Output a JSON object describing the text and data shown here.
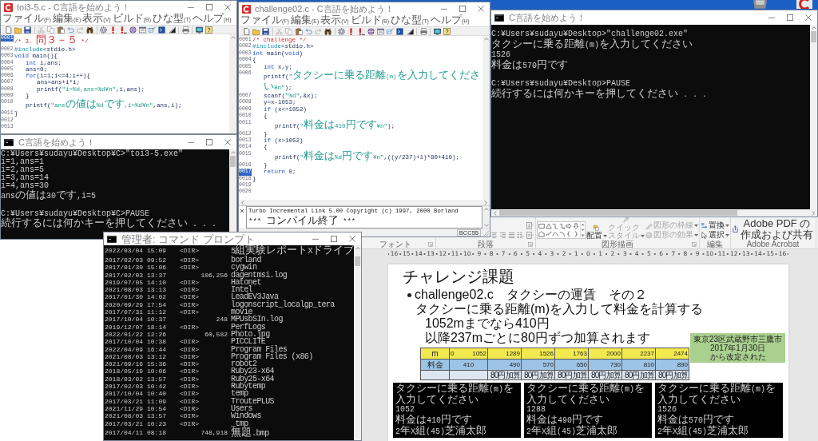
{
  "editors": [
    {
      "title": "toi3-5.c - C言語を始めよう！",
      "menu": [
        "ファイル(F)",
        "編集(E)",
        "表示(V)",
        "ビルド(B)",
        "ひな型(T)",
        "ヘルプ(H)"
      ],
      "lines": [
        {
          "number": "0001",
          "selected": true,
          "tokens": [
            {
              "kind": "comment",
              "text": "/* 3. 問３－５ */"
            }
          ]
        },
        {
          "number": "0002",
          "selected": false,
          "tokens": [
            {
              "kind": "directive",
              "text": "#include"
            },
            {
              "kind": "plain",
              "text": "<stdio.h>"
            }
          ]
        },
        {
          "number": "0003",
          "selected": false,
          "tokens": [
            {
              "kind": "keyword",
              "text": "void"
            },
            {
              "kind": "plain",
              "text": " main(){"
            }
          ]
        },
        {
          "number": "0004",
          "selected": false,
          "tokens": [
            {
              "kind": "keyword",
              "text": "    int"
            },
            {
              "kind": "plain",
              "text": " i,ans;"
            }
          ]
        },
        {
          "number": "0005",
          "selected": false,
          "tokens": [
            {
              "kind": "plain",
              "text": "    ans=0;"
            }
          ]
        },
        {
          "number": "0006",
          "selected": false,
          "tokens": [
            {
              "kind": "keyword",
              "text": "    for"
            },
            {
              "kind": "plain",
              "text": "(i=1;i<=4;i++){"
            }
          ]
        },
        {
          "number": "0007",
          "selected": false,
          "tokens": [
            {
              "kind": "plain",
              "text": "        ans=ans+i*i;"
            }
          ]
        },
        {
          "number": "0008",
          "selected": false,
          "tokens": [
            {
              "kind": "plain",
              "text": "        printf("
            },
            {
              "kind": "string",
              "text": "\"i=%d,ans=%d¥n\""
            },
            {
              "kind": "plain",
              "text": ",i,ans);"
            }
          ]
        },
        {
          "number": "0009",
          "selected": false,
          "tokens": [
            {
              "kind": "plain",
              "text": "    }"
            }
          ]
        },
        {
          "number": "0010",
          "selected": false,
          "tokens": [
            {
              "kind": "plain",
              "text": "    printf("
            },
            {
              "kind": "string",
              "text": "\"ansの値は%dです,i=%d¥n\""
            },
            {
              "kind": "plain",
              "text": ",ans,i);"
            }
          ]
        },
        {
          "number": "0011",
          "selected": false,
          "tokens": [
            {
              "kind": "plain",
              "text": "}"
            }
          ]
        },
        {
          "number": "0012",
          "selected": false
        },
        {
          "number": "0013",
          "selected": false
        }
      ]
    },
    {
      "title": "challenge02.c - C言語を始めよう！",
      "menu": [
        "ファイル(F)",
        "編集(E)",
        "表示(V)",
        "ビルド(B)",
        "ひな型(T)",
        "ヘルプ(H)"
      ],
      "lines": [
        {
          "number": "0001",
          "selected": false,
          "tokens": [
            {
              "kind": "comment",
              "text": "/* challenge */"
            }
          ]
        },
        {
          "number": "0002",
          "selected": false,
          "tokens": [
            {
              "kind": "directive",
              "text": "#include"
            },
            {
              "kind": "plain",
              "text": "<stdio.h>"
            }
          ]
        },
        {
          "number": "0003",
          "selected": false,
          "tokens": [
            {
              "kind": "keyword",
              "text": "int"
            },
            {
              "kind": "plain",
              "text": " main("
            },
            {
              "kind": "keyword",
              "text": "void"
            },
            {
              "kind": "plain",
              "text": ")"
            }
          ]
        },
        {
          "number": "0004",
          "selected": false,
          "tokens": [
            {
              "kind": "plain",
              "text": "{"
            }
          ]
        },
        {
          "number": "0005",
          "selected": false,
          "tokens": [
            {
              "kind": "keyword",
              "text": "    int"
            },
            {
              "kind": "plain",
              "text": " x,y;"
            }
          ]
        },
        {
          "number": "0006",
          "selected": false,
          "tokens": [
            {
              "kind": "plain",
              "text": "    printf("
            },
            {
              "kind": "string",
              "text": "\"タクシーに乗る距離(m)を入力してください¥n\""
            },
            {
              "kind": "plain",
              "text": ");"
            }
          ]
        },
        {
          "number": "0007",
          "selected": false,
          "tokens": [
            {
              "kind": "plain",
              "text": "    scanf("
            },
            {
              "kind": "string",
              "text": "\"%d\""
            },
            {
              "kind": "plain",
              "text": ",&x);"
            }
          ]
        },
        {
          "number": "0008",
          "selected": false,
          "tokens": [
            {
              "kind": "plain",
              "text": "    y=x-1053;"
            }
          ]
        },
        {
          "number": "0009",
          "selected": false,
          "tokens": [
            {
              "kind": "keyword",
              "text": "    if"
            },
            {
              "kind": "plain",
              "text": " (x<=1052)"
            }
          ]
        },
        {
          "number": "0010",
          "selected": false,
          "tokens": [
            {
              "kind": "plain",
              "text": "    {"
            }
          ]
        },
        {
          "number": "0011",
          "selected": false,
          "tokens": [
            {
              "kind": "plain",
              "text": "        printf("
            },
            {
              "kind": "string",
              "text": "\"料金は410円です¥n\""
            },
            {
              "kind": "plain",
              "text": ");"
            }
          ]
        },
        {
          "number": "0012",
          "selected": false,
          "tokens": [
            {
              "kind": "plain",
              "text": "    }"
            }
          ]
        },
        {
          "number": "0013",
          "selected": false,
          "tokens": [
            {
              "kind": "keyword",
              "text": "    if"
            },
            {
              "kind": "plain",
              "text": " (x>1052)"
            }
          ]
        },
        {
          "number": "0014",
          "selected": false,
          "tokens": [
            {
              "kind": "plain",
              "text": "    {"
            }
          ]
        },
        {
          "number": "0015",
          "selected": false,
          "tokens": [
            {
              "kind": "plain",
              "text": "        printf("
            },
            {
              "kind": "string",
              "text": "\"料金は%d円です¥n\""
            },
            {
              "kind": "plain",
              "text": ",((y/237)+1)*80+410);"
            }
          ]
        },
        {
          "number": "0016",
          "selected": false,
          "tokens": [
            {
              "kind": "plain",
              "text": "    }"
            }
          ]
        },
        {
          "number": "0017",
          "selected": true,
          "tokens": [
            {
              "kind": "keyword",
              "text": "    return"
            },
            {
              "kind": "plain",
              "text": " 0;"
            }
          ]
        },
        {
          "number": "0018",
          "selected": false,
          "tokens": [
            {
              "kind": "plain",
              "text": "}"
            }
          ]
        },
        {
          "number": "0019",
          "selected": false
        },
        {
          "number": "0020",
          "selected": false
        }
      ],
      "output": [
        "Turbo Incremental Link 5.00 Copyright (c) 1997, 2000 Borland",
        "*** コンパイル終了 ***"
      ],
      "status": "BCC55"
    }
  ],
  "consoles": [
    {
      "title": "C言語を始めよう！",
      "blocks": [
        [
          "C:¥Users¥sudayu¥Desktop>\"challenge02.exe\"",
          "タクシーに乗る距離(m)を入力してください",
          "1526",
          "料金は570円です"
        ],
        [
          "C:¥Users¥sudayu¥Desktop>PAUSE",
          "続行するには何かキーを押してください . . ."
        ]
      ]
    },
    {
      "title": "C言語を始めよう！",
      "blocks": [
        [
          "C:¥Users¥sudayu¥Desktop¥C>\"toi3-5.exe\"",
          "i=1,ans=1",
          "i=2,ans=5",
          "i=3,ans=14",
          "i=4,ans=30",
          "ansの値は30です,i=5"
        ],
        [
          "C:¥Users¥sudayu¥Desktop¥C>PAUSE",
          "続行するには何かキーを押してください . . ."
        ]
      ]
    }
  ],
  "command_prompt": {
    "title": "管理者: コマンド プロンプト",
    "rows": [
      {
        "date": "2022/03/04",
        "time": "15:09",
        "dir": "<DIR>",
        "name": "5組実験レポートXドライブ"
      },
      {
        "date": "2017/02/03",
        "time": "09:52",
        "dir": "<DIR>",
        "name": "borland"
      },
      {
        "date": "2017/01/30",
        "time": "15:06",
        "dir": "<DIR>",
        "name": "cygwin"
      },
      {
        "date": "2017/02/03",
        "time": "13:37",
        "size": "106,256",
        "name": "dagentmsi.log"
      },
      {
        "date": "2019/07/05",
        "time": "14:10",
        "dir": "<DIR>",
        "name": "Hatonet"
      },
      {
        "date": "2021/08/03",
        "time": "13:13",
        "dir": "<DIR>",
        "name": "Intel"
      },
      {
        "date": "2017/01/30",
        "time": "14:02",
        "dir": "<DIR>",
        "name": "LeadEV3Java"
      },
      {
        "date": "2020/09/29",
        "time": "17:54",
        "dir": "<DIR>",
        "name": "logonscript_localgp_tera"
      },
      {
        "date": "2017/07/31",
        "time": "11:12",
        "dir": "<DIR>",
        "name": "movie"
      },
      {
        "date": "2017/10/04",
        "time": "10:37",
        "size": "248",
        "name": "MPUsbSIn.log"
      },
      {
        "date": "2019/12/07",
        "time": "18:14",
        "dir": "<DIR>",
        "name": "PerfLogs"
      },
      {
        "date": "2022/01/22",
        "time": "12:26",
        "size": "60,582",
        "name": "Photo.jpg"
      },
      {
        "date": "2017/10/04",
        "time": "10:38",
        "dir": "<DIR>",
        "name": "PICCLITE"
      },
      {
        "date": "2022/04/09",
        "time": "16:44",
        "dir": "<DIR>",
        "name": "Program Files"
      },
      {
        "date": "2021/08/03",
        "time": "13:12",
        "dir": "<DIR>",
        "name": "Program Files (x86)"
      },
      {
        "date": "2021/09/16",
        "time": "15:36",
        "dir": "<DIR>",
        "name": "robot2"
      },
      {
        "date": "2018/05/19",
        "time": "10:06",
        "dir": "<DIR>",
        "name": "Ruby23-x64"
      },
      {
        "date": "2018/03/02",
        "time": "13:57",
        "dir": "<DIR>",
        "name": "Ruby25-x64"
      },
      {
        "date": "2017/02/03",
        "time": "10:42",
        "dir": "<DIR>",
        "name": "Rubytemp"
      },
      {
        "date": "2017/10/04",
        "time": "10:40",
        "dir": "<DIR>",
        "name": "temp"
      },
      {
        "date": "2017/03/21",
        "time": "11:09",
        "dir": "<DIR>",
        "name": "TroutePLUS"
      },
      {
        "date": "2021/11/29",
        "time": "10:54",
        "dir": "<DIR>",
        "name": "Users"
      },
      {
        "date": "2021/08/03",
        "time": "13:57",
        "dir": "<DIR>",
        "name": "Windows"
      },
      {
        "date": "2017/03/21",
        "time": "10:23",
        "dir": "<DIR>",
        "name": "_tmp"
      },
      {
        "date": "2017/04/11",
        "time": "08:18",
        "size": "748,918",
        "name": "無題.bmp"
      }
    ]
  },
  "presentation": {
    "ribbon": {
      "groups": [
        {
          "kind": "font",
          "label": "フォント"
        },
        {
          "kind": "paragraph",
          "label": "段落"
        },
        {
          "kind": "drawing",
          "label": "図形描画",
          "buttons": [
            {
              "kind": "large",
              "label": "配置",
              "dropdown": true,
              "disabled": false
            },
            {
              "kind": "large",
              "label": "クイックスタイル",
              "dropdown": true,
              "disabled": true
            },
            {
              "kind": "small",
              "label": "図形の枠線",
              "dropdown": true,
              "disabled": true
            },
            {
              "kind": "small",
              "label": "図形の効果",
              "dropdown": true,
              "disabled": true
            }
          ]
        },
        {
          "kind": "editing",
          "label": "編集",
          "buttons": [
            {
              "kind": "small",
              "label": "置換",
              "dropdown": true,
              "disabled": false
            },
            {
              "kind": "small",
              "label": "選択",
              "dropdown": true,
              "disabled": false
            }
          ]
        },
        {
          "kind": "acrobat",
          "label": "Adobe Acrobat",
          "buttons": [
            {
              "kind": "large",
              "label": "Adobe PDF の作成および共有",
              "dropdown": false,
              "disabled": false
            }
          ]
        }
      ]
    },
    "ruler": [
      "16",
      "15",
      "14",
      "13",
      "12",
      "11",
      "10",
      "9",
      "8",
      "7",
      "6",
      "5",
      "4",
      "3",
      "2",
      "1",
      "0",
      "1",
      "2",
      "3",
      "4",
      "5",
      "6",
      "7",
      "8",
      "9",
      "10",
      "11",
      "12",
      "13",
      "14",
      "15",
      "16"
    ],
    "slide": {
      "title": "チャレンジ課題",
      "bullets": [
        {
          "text": "challenge02.c　タクシーの運賃　その２",
          "children": [
            {
              "text": "タクシーに乗る距離(m)を入力して料金を計算する",
              "children": [
                {
                  "text": "1052mまでなら410円"
                },
                {
                  "text": "以降237mごとに80円ずつ加算されます"
                }
              ]
            }
          ]
        }
      ],
      "table": {
        "row_labels": [
          "m",
          "料金"
        ],
        "columns": [
          {
            "distances": [
              "0",
              "1052"
            ],
            "fare": "410"
          },
          {
            "distances": [
              "1289"
            ],
            "fare": "490",
            "note": "80円加算"
          },
          {
            "distances": [
              "1526"
            ],
            "fare": "570",
            "note": "80円加算"
          },
          {
            "distances": [
              "1763"
            ],
            "fare": "650",
            "note": "80円加算"
          },
          {
            "distances": [
              "2000"
            ],
            "fare": "730",
            "note": "80円加算"
          },
          {
            "distances": [
              "2237"
            ],
            "fare": "810",
            "note": "80円加算"
          },
          {
            "distances": [
              "2474"
            ],
            "fare": "890",
            "note": "80円加算"
          }
        ]
      },
      "callout": [
        "東京23区武蔵野市三鷹市",
        "2017年1月30日",
        "から改定された"
      ],
      "screenshots": [
        {
          "lines": [
            "タクシーに乗る距離(m)を入力してください",
            "1052",
            "料金は410円です",
            "2年X組(45)芝浦太郎"
          ]
        },
        {
          "lines": [
            "タクシーに乗る距離(m)を入力してください",
            "1288",
            "料金は490円です",
            "2年X組(45)芝浦太郎"
          ]
        },
        {
          "lines": [
            "タクシーに乗る距離(m)を入力してください",
            "1526",
            "料金は570円です",
            "2年X組(45)芝浦太郎"
          ]
        }
      ]
    }
  }
}
